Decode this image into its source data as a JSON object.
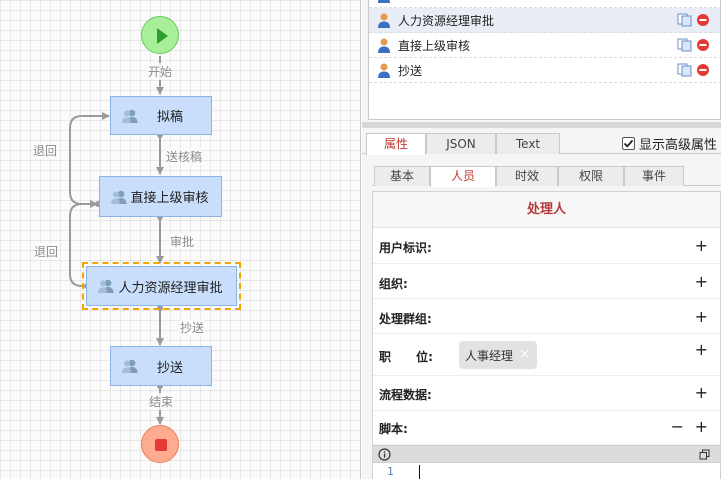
{
  "flow": {
    "edges": {
      "start_label": "开始",
      "submit_label": "送核稿",
      "approve_label": "审批",
      "cc_label": "抄送",
      "end_label": "结束",
      "back1_label": "退回",
      "back2_label": "退回"
    },
    "nodes": {
      "draft": "拟稿",
      "supervisor": "直接上级审核",
      "hr": "人力资源经理审批",
      "cc": "抄送"
    }
  },
  "users": {
    "items": [
      {
        "label": "人力资源经理审批"
      },
      {
        "label": "直接上级审核"
      },
      {
        "label": "抄送"
      }
    ]
  },
  "props": {
    "tabs": [
      "属性",
      "JSON",
      "Text"
    ],
    "show_advanced_label": "显示高级属性",
    "subtabs": [
      "基本",
      "人员",
      "时效",
      "权限",
      "事件"
    ],
    "section_title": "处理人",
    "fields": {
      "user_id": "用户标识:",
      "org": "组织:",
      "group": "处理群组:",
      "position": "职      位:",
      "flow_data": "流程数据:",
      "script": "脚本:"
    },
    "position_chip": "人事经理",
    "plus": "+",
    "minus": "−",
    "chip_remove": "×",
    "editor_line": "1"
  },
  "colors": {
    "node_fill": "#c8defa",
    "node_border": "#8db3e2",
    "selected_outline": "#f0a500",
    "start_fill": "#a9ef9a",
    "end_fill": "#ffab8f",
    "accent_red": "#c0392b"
  }
}
